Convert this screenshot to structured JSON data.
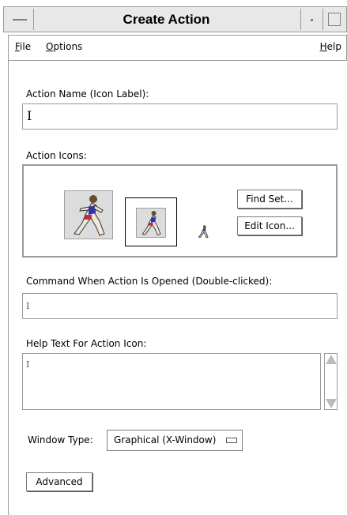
{
  "window": {
    "title": "Create Action"
  },
  "menubar": {
    "file": "File",
    "options": "Options",
    "help": "Help"
  },
  "action_name": {
    "label": "Action Name (Icon Label):",
    "value": ""
  },
  "action_icons": {
    "label": "Action Icons:",
    "find_set_button": "Find Set...",
    "edit_icon_button": "Edit Icon..."
  },
  "command": {
    "label": "Command When Action Is Opened (Double-clicked):",
    "value": ""
  },
  "help_text": {
    "label": "Help Text For Action Icon:",
    "value": ""
  },
  "window_type": {
    "label": "Window Type:",
    "selected": "Graphical (X-Window)"
  },
  "advanced_button": "Advanced",
  "icons": {
    "window_menu": "window-menu-icon",
    "minimize": "minimize-icon",
    "maximize": "maximize-icon",
    "runner": "runner-icon"
  }
}
